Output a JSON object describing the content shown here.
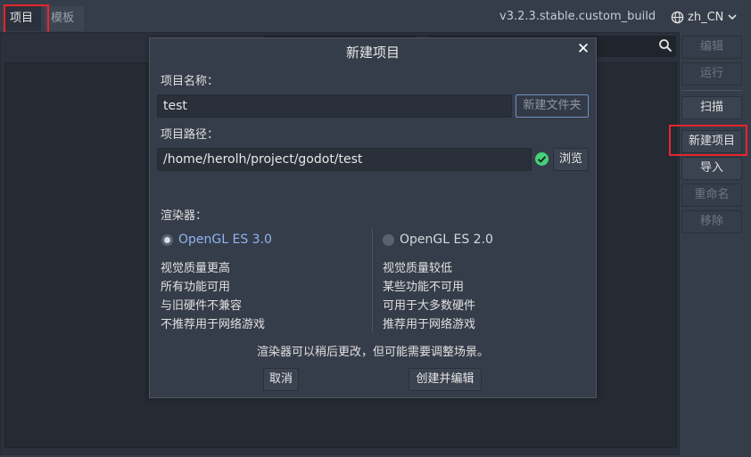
{
  "tabs": {
    "projects": "项目",
    "templates": "模板"
  },
  "version": "v3.2.3.stable.custom_build",
  "language": "zh_CN",
  "sidebar": {
    "edit": "编辑",
    "run": "运行",
    "scan": "扫描",
    "new_project": "新建项目",
    "import": "导入",
    "rename": "重命名",
    "remove": "移除"
  },
  "dialog": {
    "title": "新建项目",
    "close": "✕",
    "name_label": "项目名称：",
    "name_value": "test",
    "new_folder": "新建文件夹",
    "path_label": "项目路径：",
    "path_value": "/home/herolh/project/godot/test",
    "browse": "浏览",
    "renderer_label": "渲染器：",
    "renderers": [
      {
        "name": "OpenGL ES 3.0",
        "selected": true,
        "lines": [
          "视觉质量更高",
          "所有功能可用",
          "与旧硬件不兼容",
          "不推荐用于网络游戏"
        ]
      },
      {
        "name": "OpenGL ES 2.0",
        "selected": false,
        "lines": [
          "视觉质量较低",
          "某些功能不可用",
          "可用于大多数硬件",
          "推荐用于网络游戏"
        ]
      }
    ],
    "note": "渲染器可以稍后更改，但可能需要调整场景。",
    "cancel": "取消",
    "create": "创建并编辑"
  },
  "colors": {
    "background": "#363d4a",
    "panel": "#2b313c",
    "accent": "#8db4f0",
    "highlight": "#e8262b",
    "valid": "#45d27a"
  }
}
